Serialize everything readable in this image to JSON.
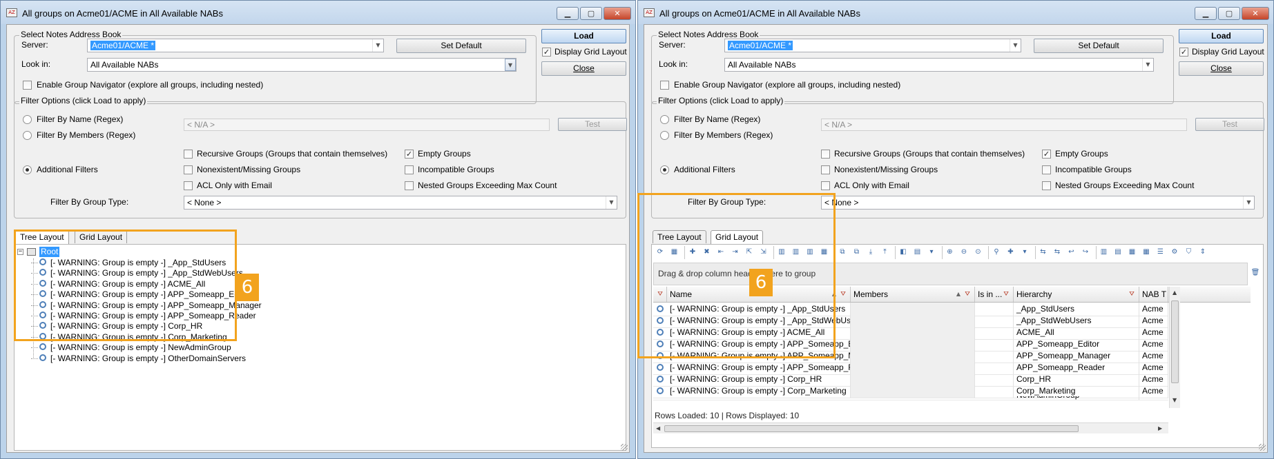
{
  "title": "All groups on Acme01/ACME in All Available NABs",
  "app_icon_text": "AZ",
  "window_buttons": {
    "minimize": "▁",
    "maximize": "▢",
    "close": "✕"
  },
  "nab_section": {
    "title": "Select Notes Address Book",
    "server_label": "Server:",
    "server_value": "Acme01/ACME *",
    "lookin_label": "Look in:",
    "lookin_value": "All Available NABs",
    "set_default": "Set Default",
    "enable_navigator": "Enable Group Navigator (explore all groups, including nested)"
  },
  "side_buttons": {
    "load": "Load",
    "display_grid": "Display Grid Layout",
    "close": "Close"
  },
  "filters": {
    "title": "Filter Options (click Load to apply)",
    "by_name": "Filter By Name (Regex)",
    "by_members": "Filter By Members (Regex)",
    "additional": "Additional Filters",
    "na_value": "< N/A >",
    "test": "Test",
    "recursive": "Recursive Groups (Groups that contain themselves)",
    "nonexistent": "Nonexistent/Missing Groups",
    "acl_only": "ACL Only with Email",
    "empty": "Empty Groups",
    "incompatible": "Incompatible Groups",
    "nested": "Nested Groups Exceeding Max Count",
    "group_type_label": "Filter By Group Type:",
    "group_type_value": "< None >",
    "checked_mark": "✓"
  },
  "tabs": {
    "tree": "Tree Layout",
    "grid": "Grid Layout"
  },
  "tree": {
    "root": "Root",
    "expander": "−",
    "items": [
      "[- WARNING: Group is empty -] _App_StdUsers",
      "[- WARNING: Group is empty -] _App_StdWebUsers",
      "[- WARNING: Group is empty -] ACME_All",
      "[- WARNING: Group is empty -] APP_Someapp_Editor",
      "[- WARNING: Group is empty -] APP_Someapp_Manager",
      "[- WARNING: Group is empty -] APP_Someapp_Reader",
      "[- WARNING: Group is empty -] Corp_HR",
      "[- WARNING: Group is empty -] Corp_Marketing",
      "[- WARNING: Group is empty -] NewAdminGroup",
      "[- WARNING: Group is empty -] OtherDomainServers"
    ]
  },
  "badge": "6",
  "grid": {
    "group_hint": "Drag & drop column headers here to group",
    "columns": [
      "Name",
      "Members",
      "Is in ...",
      "Hierarchy",
      "NAB T"
    ],
    "rows": [
      [
        "[- WARNING: Group is empty -] _App_StdUsers",
        "",
        "",
        "_App_StdUsers",
        "Acme"
      ],
      [
        "[- WARNING: Group is empty -] _App_StdWebUsers",
        "",
        "",
        "_App_StdWebUsers",
        "Acme"
      ],
      [
        "[- WARNING: Group is empty -] ACME_All",
        "",
        "",
        "ACME_All",
        "Acme"
      ],
      [
        "[- WARNING: Group is empty -] APP_Someapp_Editor",
        "",
        "",
        "APP_Someapp_Editor",
        "Acme"
      ],
      [
        "[- WARNING: Group is empty -] APP_Someapp_Manager",
        "",
        "",
        "APP_Someapp_Manager",
        "Acme"
      ],
      [
        "[- WARNING: Group is empty -] APP_Someapp_Reader",
        "",
        "",
        "APP_Someapp_Reader",
        "Acme"
      ],
      [
        "[- WARNING: Group is empty -] Corp_HR",
        "",
        "",
        "Corp_HR",
        "Acme"
      ],
      [
        "[- WARNING: Group is empty -] Corp_Marketing",
        "",
        "",
        "Corp_Marketing",
        "Acme"
      ]
    ],
    "partial_row_hierarchy": "NewAdminGroup",
    "status": "Rows Loaded: 10  |  Rows Displayed: 10",
    "toolbar_icons": [
      "⟳",
      "▦",
      "✚",
      "✖",
      "⇤",
      "⇥",
      "⇱",
      "⇲",
      "▥",
      "▥",
      "▥",
      "▦",
      "⧉",
      "⧉",
      "⤓",
      "⤒",
      "◧",
      "▤",
      "▾",
      "⊕",
      "⊖",
      "⊙",
      "⚲",
      "✚",
      "▾",
      "⇆",
      "⇆",
      "↩",
      "↪",
      "▥",
      "▤",
      "▦",
      "▦",
      "☰",
      "⚙",
      "⛉",
      "⇕"
    ],
    "trash_icon": "🗑",
    "filter_glyph": "⛛",
    "sort_glyph": "▲"
  },
  "scroll": {
    "up": "▲",
    "down": "▼",
    "left": "◀",
    "right": "▶"
  },
  "colors": {
    "highlight": "#f2a31e",
    "selection": "#3399ff",
    "window_frame": "#bcd3ea"
  }
}
